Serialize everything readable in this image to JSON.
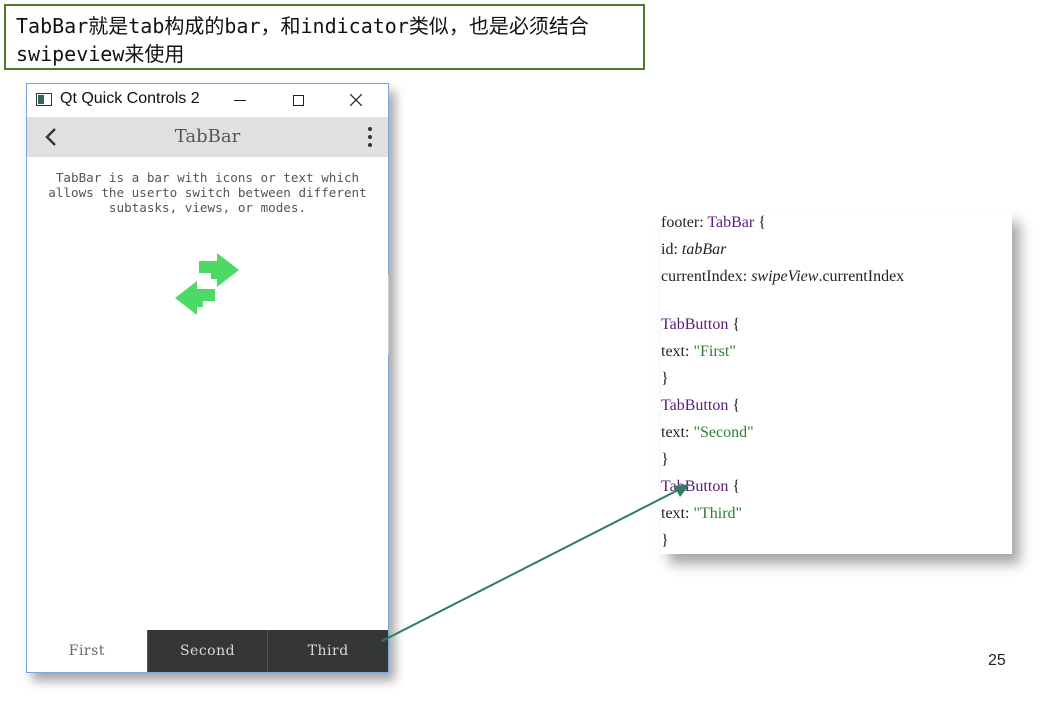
{
  "slide": {
    "title": "TabBar就是tab构成的bar，和indicator类似，也是必须结合swipeview来使用",
    "page_number": "25"
  },
  "window": {
    "title": "Qt Quick Controls 2",
    "toolbar_title": "TabBar",
    "description": "TabBar is a bar with icons or text which allows the userto switch between different subtasks, views, or modes.",
    "tabs": [
      "First",
      "Second",
      "Third"
    ],
    "icon": "app-icon",
    "accent_green": "#4cd964"
  },
  "code": {
    "lines": [
      {
        "a": "footer: ",
        "b": "TabBar",
        "c": " {"
      },
      {
        "a": "id: ",
        "b": "tabBar"
      },
      {
        "a": "currentIndex: ",
        "b": "swipeView",
        "c": ".currentIndex"
      },
      {
        "a": "TabButton",
        "b": " {"
      },
      {
        "a": "text: ",
        "b": "\"First\""
      },
      {
        "a": "}"
      },
      {
        "a": "TabButton",
        "b": " {"
      },
      {
        "a": "text: ",
        "b": "\"Second\""
      },
      {
        "a": "}"
      },
      {
        "a": "TabButton",
        "b": " {"
      },
      {
        "a": "text: ",
        "b": "\"Third\""
      },
      {
        "a": "}"
      }
    ]
  },
  "colors": {
    "title_border": "#4e7a2c",
    "arrow": "#2e7d5e",
    "tab_dark": "#353637",
    "keyword": "#5b1a7a",
    "string": "#2e7d32"
  }
}
